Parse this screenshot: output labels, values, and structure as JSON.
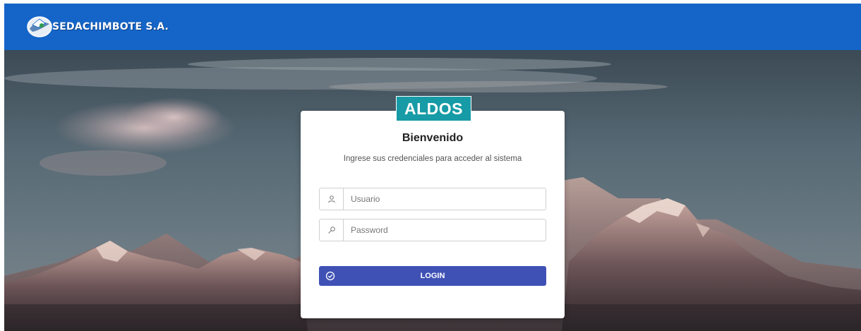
{
  "header": {
    "company_name": "SEDACHIMBOTE S.A.",
    "logo_icon": "company-logo-icon",
    "background_color": "#1565c8"
  },
  "login": {
    "app_badge": "ALDOS",
    "badge_color": "#179ba6",
    "title": "Bienvenido",
    "subtitle": "Ingrese sus credenciales para acceder al sistema",
    "username": {
      "placeholder": "Usuario",
      "value": "",
      "icon": "user-icon"
    },
    "password": {
      "placeholder": "Password",
      "value": "",
      "icon": "key-icon"
    },
    "submit": {
      "label": "LOGIN",
      "icon": "check-circle-icon",
      "color": "#3f51b5"
    }
  }
}
